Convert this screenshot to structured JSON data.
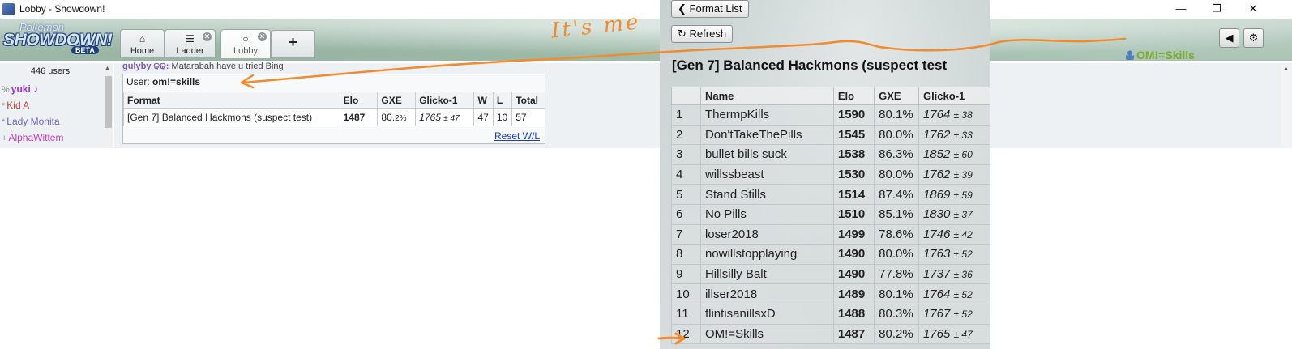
{
  "window": {
    "title": "Lobby - Showdown!",
    "minimize": "—",
    "restore": "❐",
    "close": "✕"
  },
  "logo": {
    "pokemon": "Pokémon",
    "showdown": "SHOWDOWN!",
    "beta": "BETA"
  },
  "tabs": [
    {
      "label": "Home",
      "icon": "home-icon"
    },
    {
      "label": "Ladder",
      "icon": "list-icon"
    },
    {
      "label": "Lobby",
      "icon": "chat-bubble-icon"
    }
  ],
  "add_tab": "+",
  "user": {
    "name": "OM!=Skills"
  },
  "userlist": {
    "count": "446 users",
    "users": [
      {
        "rank": "%",
        "name": "yuki ♪",
        "color": "#9b32d6",
        "bold": true
      },
      {
        "rank": "*",
        "name": "Kid A",
        "color": "#c0473f",
        "bold": false
      },
      {
        "rank": "*",
        "name": "Lady Monita",
        "color": "#6b67c9",
        "bold": false
      },
      {
        "rank": "+",
        "name": "AlphaWittem",
        "color": "#c43cc6",
        "bold": false
      }
    ]
  },
  "chat": {
    "name": "gulyby ଢଢ:",
    "message": "Matarabah have u tried Bing"
  },
  "rankbox": {
    "user_label": "User:",
    "user_name": "om!=skills",
    "headers": [
      "Format",
      "Elo",
      "GXE",
      "Glicko-1",
      "W",
      "L",
      "Total"
    ],
    "row": {
      "format": "[Gen 7] Balanced Hackmons (suspect test)",
      "elo": "1487",
      "gxe": "80.",
      "gxe_dec": "2%",
      "glicko": "1765",
      "glicko_dev": "± 47",
      "w": "47",
      "l": "10",
      "total": "57"
    },
    "reset": "Reset W/L"
  },
  "ladder": {
    "format_list": "Format List",
    "refresh": "Refresh",
    "title": "[Gen 7] Balanced Hackmons (suspect test",
    "headers": [
      "",
      "Name",
      "Elo",
      "GXE",
      "Glicko-1"
    ],
    "rows": [
      {
        "rank": "1",
        "name": "ThermpKills",
        "elo": "1590",
        "gxe": "80.1%",
        "glicko": "1764",
        "dev": "± 38"
      },
      {
        "rank": "2",
        "name": "Don'tTakeThePills",
        "elo": "1545",
        "gxe": "80.0%",
        "glicko": "1762",
        "dev": "± 33"
      },
      {
        "rank": "3",
        "name": "bullet bills suck",
        "elo": "1538",
        "gxe": "86.3%",
        "glicko": "1852",
        "dev": "± 60"
      },
      {
        "rank": "4",
        "name": "willssbeast",
        "elo": "1530",
        "gxe": "80.0%",
        "glicko": "1762",
        "dev": "± 39"
      },
      {
        "rank": "5",
        "name": "Stand Stills",
        "elo": "1514",
        "gxe": "87.4%",
        "glicko": "1869",
        "dev": "± 59"
      },
      {
        "rank": "6",
        "name": "No Pills",
        "elo": "1510",
        "gxe": "85.1%",
        "glicko": "1830",
        "dev": "± 37"
      },
      {
        "rank": "7",
        "name": "loser2018",
        "elo": "1499",
        "gxe": "78.6%",
        "glicko": "1746",
        "dev": "± 42"
      },
      {
        "rank": "8",
        "name": "nowillstopplaying",
        "elo": "1490",
        "gxe": "80.0%",
        "glicko": "1763",
        "dev": "± 52"
      },
      {
        "rank": "9",
        "name": "Hillsilly Balt",
        "elo": "1490",
        "gxe": "77.8%",
        "glicko": "1737",
        "dev": "± 36"
      },
      {
        "rank": "10",
        "name": "illser2018",
        "elo": "1489",
        "gxe": "80.1%",
        "glicko": "1764",
        "dev": "± 52"
      },
      {
        "rank": "11",
        "name": "flintisanillsxD",
        "elo": "1488",
        "gxe": "80.3%",
        "glicko": "1767",
        "dev": "± 52"
      },
      {
        "rank": "12",
        "name": "OM!=Skills",
        "elo": "1487",
        "gxe": "80.2%",
        "glicko": "1765",
        "dev": "± 47"
      }
    ]
  },
  "annotation": {
    "text": "It's me",
    "color": "#f28a2e"
  }
}
